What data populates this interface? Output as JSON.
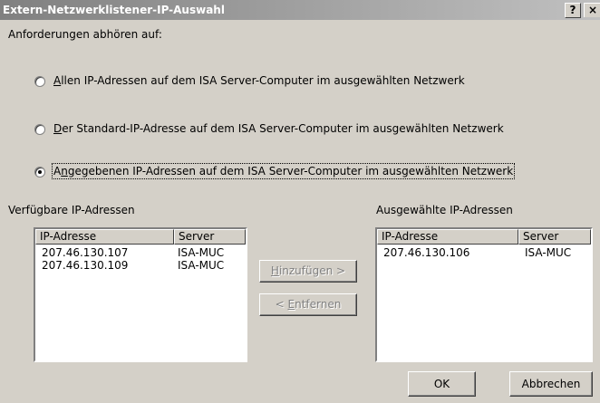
{
  "window": {
    "title": "Extern-Netzwerklistener-IP-Auswahl",
    "help_glyph": "?",
    "close_glyph": "×"
  },
  "prompt": "Anforderungen abhören auf:",
  "options": [
    {
      "label": "Allen IP-Adressen auf dem ISA Server-Computer im ausgewählten Netzwerk",
      "checked": false
    },
    {
      "label": "Der Standard-IP-Adresse auf dem ISA Server-Computer im ausgewählten Netzwerk",
      "checked": false
    },
    {
      "label": "Angegebenen IP-Adressen auf dem ISA Server-Computer im ausgewählten Netzwerk",
      "checked": true
    }
  ],
  "available": {
    "heading": "Verfügbare IP-Adressen",
    "columns": [
      "IP-Adresse",
      "Server"
    ],
    "rows": [
      [
        "207.46.130.107",
        "ISA-MUC"
      ],
      [
        "207.46.130.109",
        "ISA-MUC"
      ]
    ]
  },
  "selected": {
    "heading": "Ausgewählte IP-Adressen",
    "columns": [
      "IP-Adresse",
      "Server"
    ],
    "rows": [
      [
        "207.46.130.106",
        "ISA-MUC"
      ]
    ]
  },
  "buttons": {
    "add": "Hinzufügen >",
    "remove": "< Entfernen",
    "ok": "OK",
    "cancel": "Abbrechen"
  }
}
